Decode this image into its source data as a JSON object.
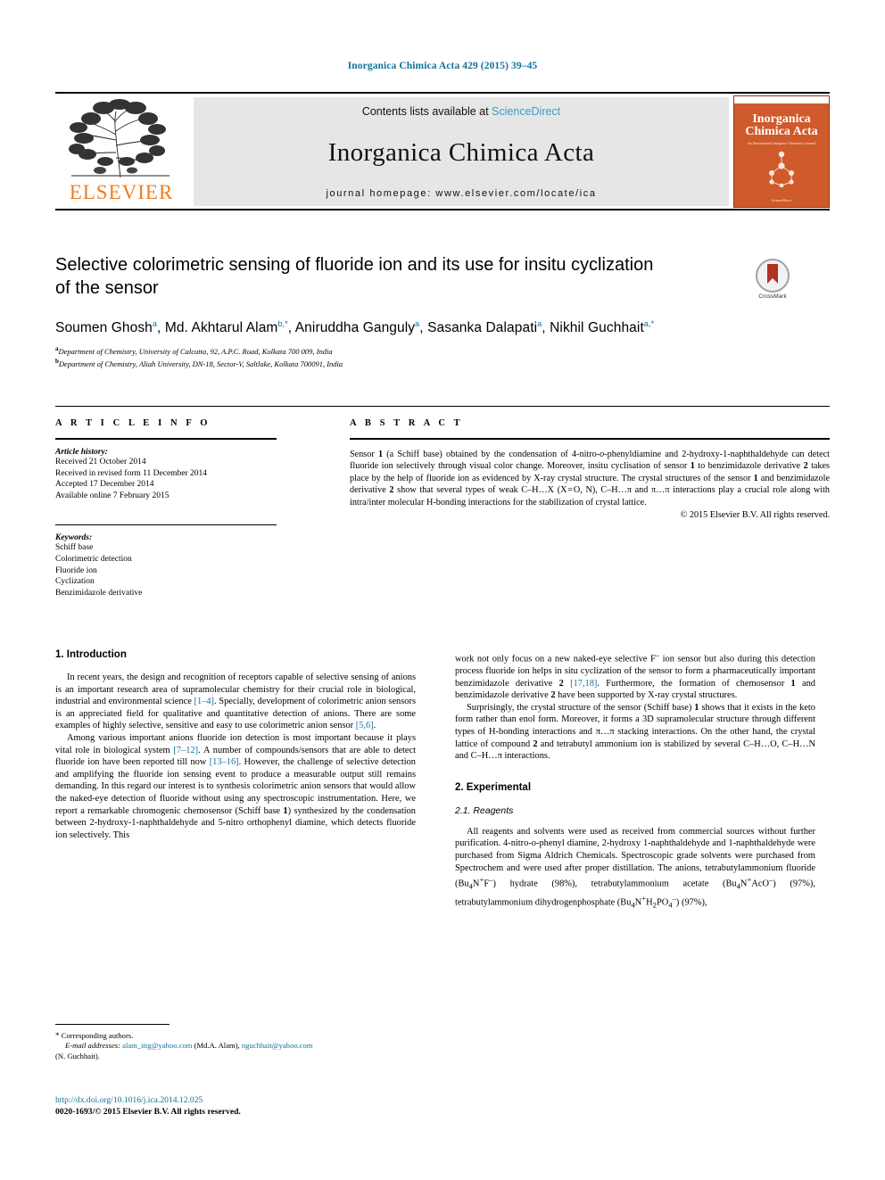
{
  "running_head": "Inorganica Chimica Acta 429 (2015) 39–45",
  "masthead": {
    "contents_prefix": "Contents lists available at ",
    "sciencedirect": "ScienceDirect",
    "journal_title": "Inorganica Chimica Acta",
    "homepage": "journal homepage: www.elsevier.com/locate/ica",
    "publisher": "ELSEVIER",
    "cover": {
      "line1": "Inorganica",
      "line2": "Chimica Acta",
      "subtitle": "An International Inorganic Chemistry Journal",
      "footer": "ScienceDirect"
    }
  },
  "article": {
    "title": "Selective colorimetric sensing of fluoride ion and its use for insitu cyclization of the sensor",
    "crossmark_label": "CrossMark",
    "authors_html": "Soumen Ghosh<sup>a</sup>, Md. Akhtarul Alam<sup>b,</sup><sup>*</sup>, Aniruddha Ganguly<sup>a</sup>, Sasanka Dalapati<sup>a</sup>, Nikhil Guchhait<sup>a,</sup><sup>*</sup>",
    "affiliations": [
      "Department of Chemistry, University of Calcutta, 92, A.P.C. Road, Kolkata 700 009, India",
      "Department of Chemistry, Aliah University, DN-18, Sector-V, Saltlake, Kolkata 700091, India"
    ],
    "affiliation_marks": [
      "a",
      "b"
    ]
  },
  "article_info": {
    "heading": "A R T I C L E  I N F O",
    "history_label": "Article history:",
    "history": [
      "Received 21 October 2014",
      "Received in revised form 11 December 2014",
      "Accepted 17 December 2014",
      "Available online 7 February 2015"
    ],
    "keywords_label": "Keywords:",
    "keywords": [
      "Schiff base",
      "Colorimetric detection",
      "Fluoride ion",
      "Cyclization",
      "Benzimidazole derivative"
    ]
  },
  "abstract": {
    "heading": "A B S T R A C T",
    "body_html": "Sensor <b>1</b> (a Schiff base) obtained by the condensation of 4-nitro-<i>o</i>-phenyldiamine and 2-hydroxy-1-naphthaldehyde can detect fluoride ion selectively through visual color change. Moreover, insitu cyclisation of sensor <b>1</b> to benzimidazole derivative <b>2</b> takes place by the help of fluoride ion as evidenced by X-ray crystal structure. The crystal structures of the sensor <b>1</b> and benzimidazole derivative <b>2</b> show that several types of weak C–H&#8230;X (X&#8202;=&#8202;O, N), C–H&#8230;&#960; and &#960;&#8230;&#960; interactions play a crucial role along with intra/inter molecular H-bonding interactions for the stabilization of crystal lattice.",
    "copyright": "© 2015 Elsevier B.V. All rights reserved."
  },
  "sections": {
    "introduction": {
      "heading": "1. Introduction",
      "paragraphs_html": [
        "In recent years, the design and recognition of receptors capable of selective sensing of anions is an important research area of supramolecular chemistry for their crucial role in biological, industrial and environmental science <span class=\"ref\">[1–4]</span>. Specially, development of colorimetric anion sensors is an appreciated field for qualitative and quantitative detection of anions. There are some examples of highly selective, sensitive and easy to use colorimetric anion sensor <span class=\"ref\">[5,6]</span>.",
        "Among various important anions fluoride ion detection is most important because it plays vital role in biological system <span class=\"ref\">[7–12]</span>. A number of compounds/sensors that are able to detect fluoride ion have been reported till now <span class=\"ref\">[13–16]</span>. However, the challenge of selective detection and amplifying the fluoride ion sensing event to produce a measurable output still remains demanding. In this regard our interest is to synthesis colorimetric anion sensors that would allow the naked-eye detection of fluoride without using any spectroscopic instrumentation. Here, we report a remarkable chromogenic chemosensor (Schiff base <b>1</b>) synthesized by the condensation between 2-hydroxy-1-naphthaldehyde and 5-nitro orthophenyl diamine, which detects fluoride ion selectively. This"
      ],
      "continuation_html": [
        "work not only focus on a new naked-eye selective F<sup>–</sup> ion sensor but also during this detection process fluoride ion helps in situ cyclization of the sensor to form a pharmaceutically important benzimidazole derivative <b>2</b> <span class=\"ref\">[17,18]</span>. Furthermore, the formation of chemosensor <b>1</b> and benzimidazole derivative <b>2</b> have been supported by X-ray crystal structures.",
        "Surprisingly, the crystal structure of the sensor (Schiff base) <b>1</b> shows that it exists in the keto form rather than enol form. Moreover, it forms a 3D supramolecular structure through different types of H-bonding interactions and &#960;&#8230;&#960; stacking interactions. On the other hand, the crystal lattice of compound <b>2</b> and tetrabutyl ammonium ion is stabilized by several C–H&#8230;O, C–H&#8230;N and C–H&#8230;&#960; interactions."
      ]
    },
    "experimental": {
      "heading": "2. Experimental",
      "subheading": "2.1. Reagents",
      "paragraph_html": "All reagents and solvents were used as received from commercial sources without further purification. 4-nitro-o-phenyl diamine, 2-hydroxy 1-naphthaldehyde and 1-naphthaldehyde were purchased from Sigma Aldrich Chemicals. Spectroscopic grade solvents were purchased from Spectrochem and were used after proper distillation. The anions, tetrabutylammonium fluoride (Bu<sub>4</sub>N<sup>+</sup>F<sup>–</sup>) hydrate (98%), tetrabutylammonium acetate (Bu<sub>4</sub>N<sup>+</sup>AcO<sup>–</sup>) (97%), tetrabutylammonium dihydrogenphosphate (Bu<sub>4</sub>N<sup>+</sup>H<sub>2</sub>PO<sub>4</sub><sup>–</sup>) (97%),"
    }
  },
  "footnotes": {
    "corresponding_marker": "*",
    "corresponding_text": "Corresponding authors.",
    "email_label": "E-mail addresses:",
    "emails": [
      {
        "address": "alam_iitg@yahoo.com",
        "owner": "(Md.A. Alam)"
      },
      {
        "address": "nguchhait@yahoo.com",
        "owner": "(N. Guchhait)"
      }
    ],
    "email_line_html": "<span class=\"fn-em\">E-mail addresses:</span> <span class=\"mail\">alam_iitg@yahoo.com</span> (Md.A. Alam), <span class=\"mail\">nguchhait@yahoo.com</span>",
    "email_line2": "(N. Guchhait)."
  },
  "footer": {
    "doi": "http://dx.doi.org/10.1016/j.ica.2014.12.025",
    "issn_line": "0020-1693/© 2015 Elsevier B.V. All rights reserved."
  },
  "colors": {
    "link": "#12739b",
    "elsevier_orange": "#f07c1f",
    "cover_orange": "#cf5a2b",
    "panel_grey": "#e6e6e6"
  }
}
